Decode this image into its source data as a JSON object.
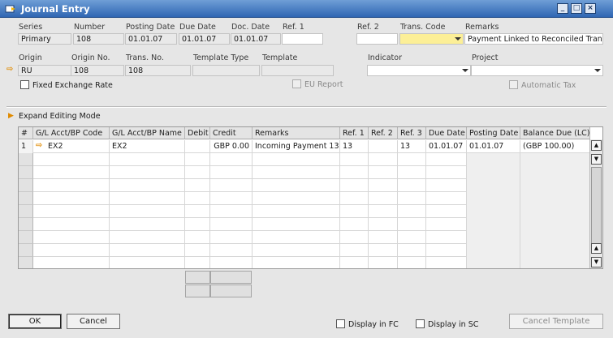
{
  "window": {
    "title": "Journal Entry",
    "controls": {
      "minimize": "_",
      "maximize": "□",
      "close": "×"
    }
  },
  "header": {
    "labels": {
      "series": "Series",
      "number": "Number",
      "posting_date": "Posting Date",
      "due_date": "Due Date",
      "doc_date": "Doc. Date",
      "ref1": "Ref. 1",
      "ref2": "Ref. 2",
      "trans_code": "Trans. Code",
      "remarks": "Remarks",
      "origin": "Origin",
      "origin_no": "Origin No.",
      "trans_no": "Trans. No.",
      "template_type": "Template Type",
      "template": "Template",
      "indicator": "Indicator",
      "project": "Project"
    },
    "values": {
      "series": "Primary",
      "number": "108",
      "posting_date": "01.01.07",
      "due_date": "01.01.07",
      "doc_date": "01.01.07",
      "ref1": "",
      "ref2": "",
      "trans_code": "",
      "remarks": "Payment Linked to Reconciled Transa",
      "origin": "RU",
      "origin_no": "108",
      "trans_no": "108",
      "template_type": "",
      "template": "",
      "indicator": "",
      "project": ""
    }
  },
  "options": {
    "fixed_exchange_rate": "Fixed Exchange Rate",
    "eu_report": "EU Report",
    "automatic_tax": "Automatic Tax",
    "expand_editing_mode": "Expand Editing Mode"
  },
  "grid": {
    "columns": [
      "#",
      "G/L Acct/BP Code",
      "G/L Acct/BP Name",
      "Debit",
      "Credit",
      "Remarks",
      "Ref. 1",
      "Ref. 2",
      "Ref. 3",
      "Due Date",
      "Posting Date",
      "Balance Due (LC)"
    ],
    "rows": [
      {
        "num": "1",
        "code": "EX2",
        "name": "EX2",
        "debit": "",
        "credit": "GBP 0.00",
        "remarks": "Incoming Payment 13",
        "ref1": "13",
        "ref2": "",
        "ref3": "13",
        "due_date": "01.01.07",
        "posting_date": "01.01.07",
        "balance_due": "(GBP 100.00)"
      }
    ]
  },
  "footer": {
    "ok": "OK",
    "cancel": "Cancel",
    "display_in_fc": "Display in FC",
    "display_in_sc": "Display in SC",
    "cancel_template": "Cancel Template"
  }
}
